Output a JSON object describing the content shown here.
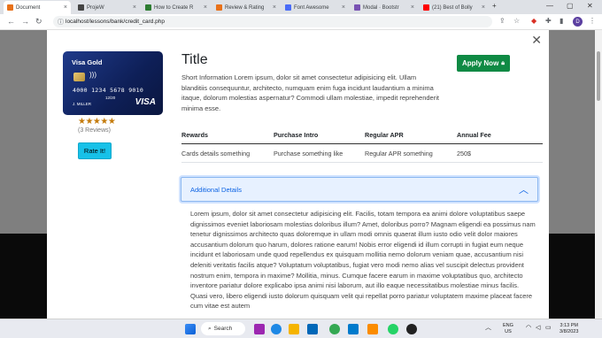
{
  "browser": {
    "tabs": [
      {
        "title": "Document",
        "color": "#e8711a",
        "active": true
      },
      {
        "title": "ProjeW",
        "color": "#444444",
        "active": false
      },
      {
        "title": "How to Create R",
        "color": "#2e7d32",
        "active": false
      },
      {
        "title": "Review & Rating",
        "color": "#e8711a",
        "active": false
      },
      {
        "title": "Font Awesome",
        "color": "#4a6cf7",
        "active": false
      },
      {
        "title": "Modal · Bootstr",
        "color": "#7952b3",
        "active": false
      },
      {
        "title": "(21) Best of Bolly",
        "color": "#ff0000",
        "active": false
      }
    ],
    "url": "localhost/lessons/bank/credit_card.php",
    "profile_initial": "D"
  },
  "modal": {
    "card": {
      "brand": "Visa Gold",
      "number": "4000 1234 5678 9010",
      "expiry": "12/20",
      "holder": "J. MILLER",
      "network": "VISA"
    },
    "rating": {
      "stars": "★★★★★",
      "reviews": "(3 Reviews)"
    },
    "rate_button": "Rate It!",
    "title": "Title",
    "description": "Short Information Lorem ipsum, dolor sit amet consectetur adipisicing elit. Ullam blanditiis consequuntur, architecto, numquam enim fuga incidunt laudantium a minima itaque, dolorum molestias aspernatur? Commodi ullam molestiae, impedit reprehenderit minima esse.",
    "apply_button": "Apply Now",
    "table": {
      "headers": [
        "Rewards",
        "Purchase Intro",
        "Regular APR",
        "Annual Fee"
      ],
      "row": [
        "Cards details something",
        "Purchase something like",
        "Regular APR something",
        "250$"
      ]
    },
    "accordion": {
      "label": "Additional Details",
      "body": "Lorem ipsum, dolor sit amet consectetur adipisicing elit. Facilis, totam tempora ea animi dolore voluptatibus saepe dignissimos eveniet laboriosam molestias doloribus illum? Amet, doloribus porro? Magnam eligendi ea possimus nam tenetur dignissimos architecto quas doloremque in ullam modi omnis quaerat illum iusto odio velit dolor maiores accusantium dolorum quo harum, dolores ratione earum! Nobis error eligendi id illum corrupti in fugiat eum neque incidunt et laboriosam unde quod repellendus ex quisquam mollitia nemo dolorum veniam quae, accusantium nisi deleniti veritatis facilis atque? Voluptatum voluptatibus, fugiat vero modi nemo alias vel suscipit delectus provident nostrum enim, tempora in maxime? Mollitia, minus. Cumque facere earum in maxime voluptatibus quo, architecto inventore pariatur dolore explicabo ipsa animi nisi laborum, aut illo eaque necessitatibus molestiae minus facilis. Quasi vero, libero eligendi iusto dolorum quisquam velit qui repellat porro pariatur voluptatem maxime placeat facere cum vitae est autem"
    }
  },
  "taskbar": {
    "search_label": "Search",
    "language": "ENG",
    "region": "US",
    "time": "3:13 PM",
    "date": "3/8/2023"
  }
}
